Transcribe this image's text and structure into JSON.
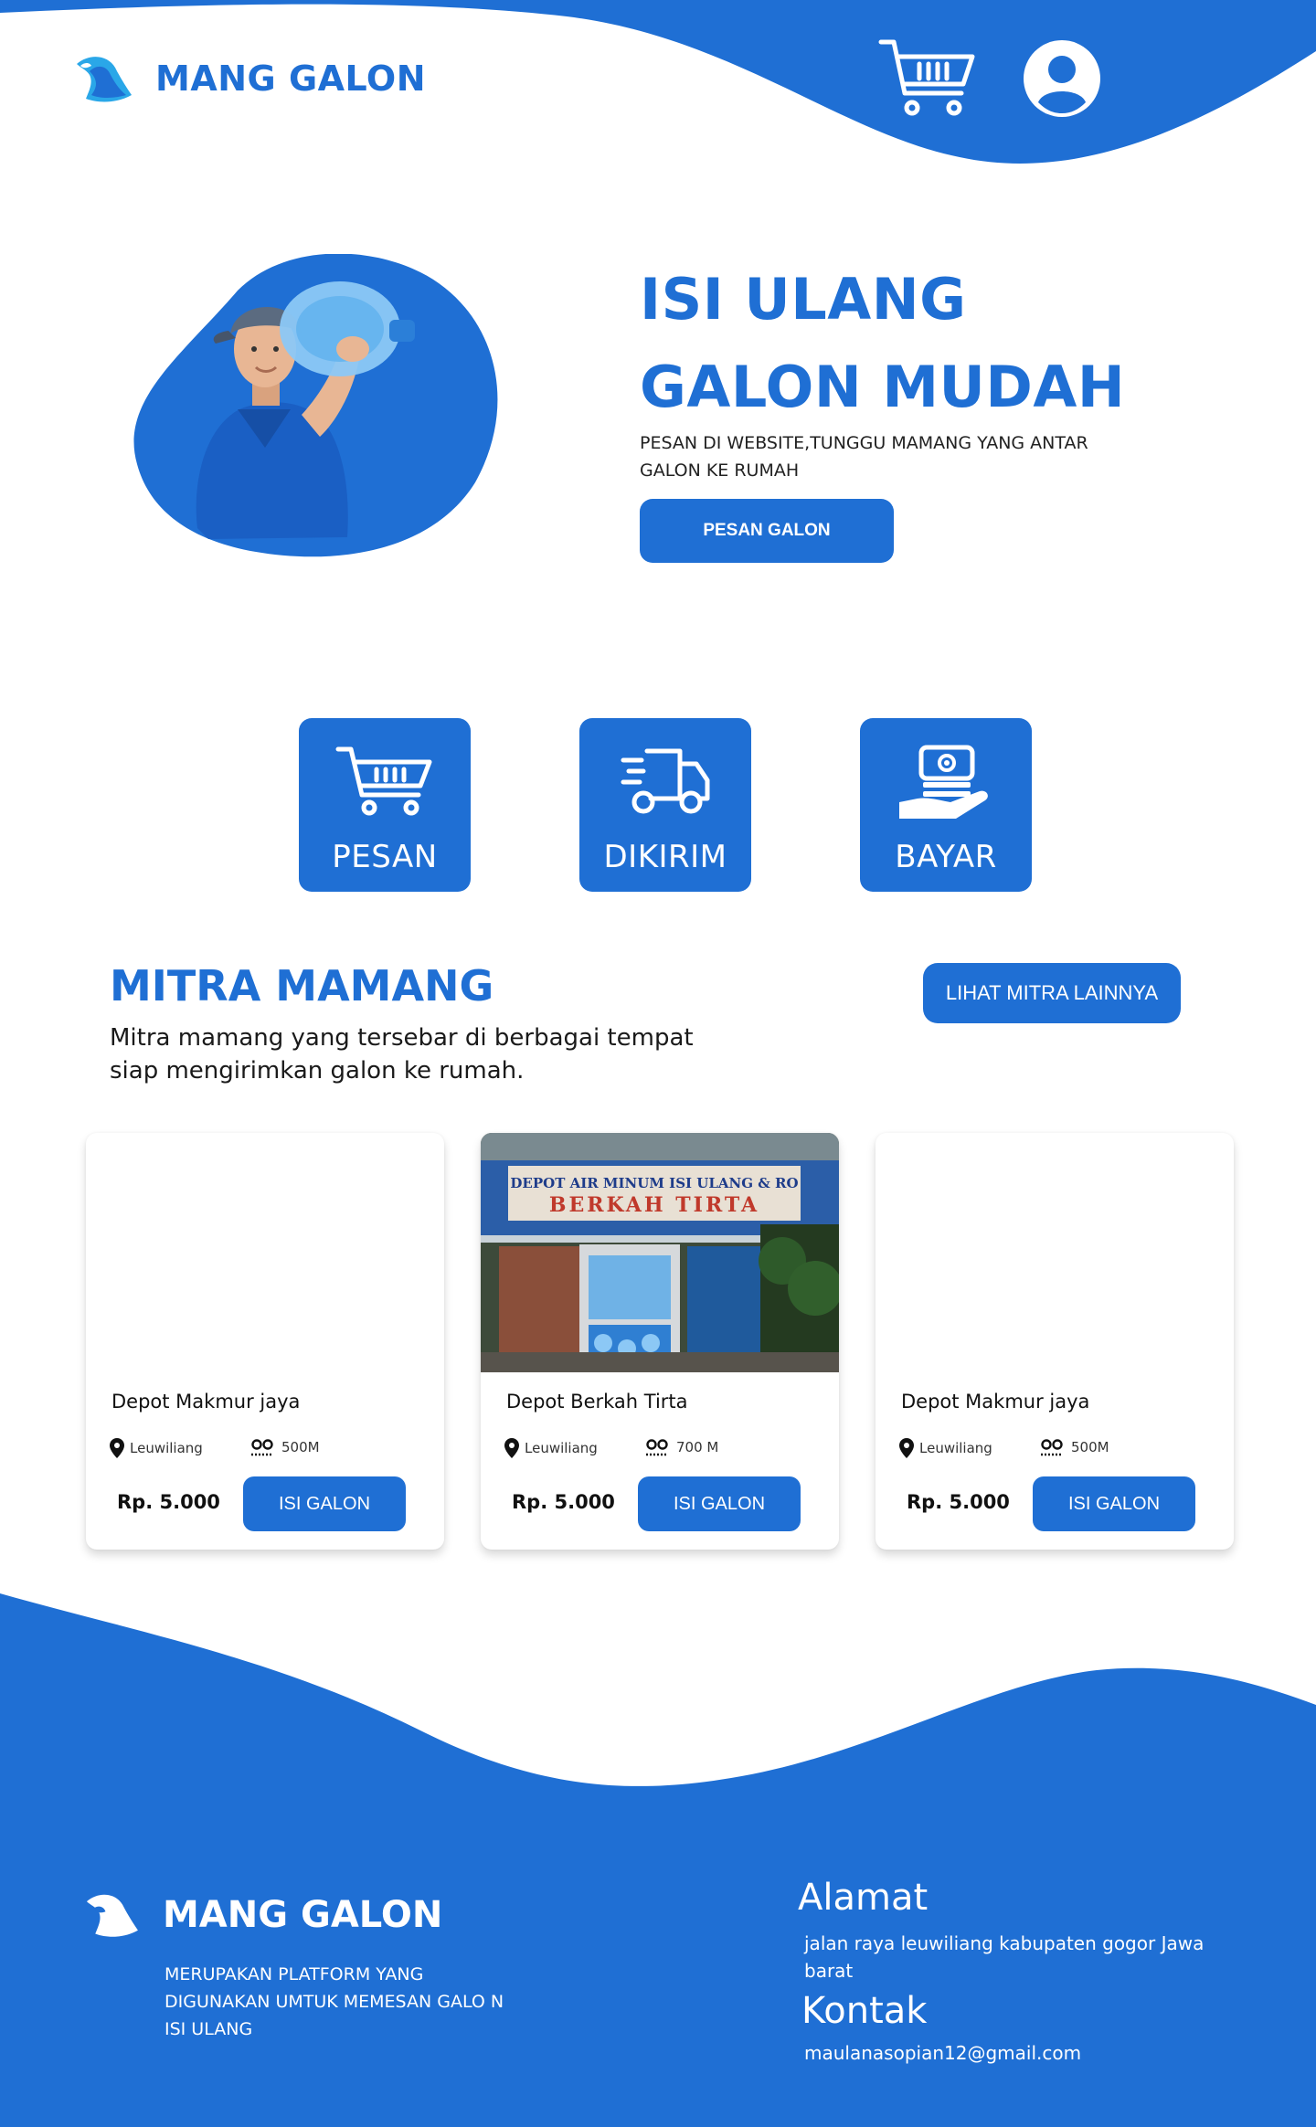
{
  "brand": {
    "name": "MANG GALON",
    "color": "#1f6fd4"
  },
  "header": {
    "cart_icon": "cart-icon",
    "profile_icon": "user-avatar-icon"
  },
  "hero": {
    "title_line1": "ISI ULANG",
    "title_line2": "GALON MUDAH",
    "description": "PESAN DI WEBSITE,TUNGGU MAMANG YANG ANTAR GALON KE RUMAH",
    "button_label": "PESAN GALON"
  },
  "steps": [
    {
      "label": "PESAN",
      "icon": "cart-icon"
    },
    {
      "label": "DIKIRIM",
      "icon": "delivery-truck-icon"
    },
    {
      "label": "BAYAR",
      "icon": "cash-hand-icon"
    }
  ],
  "mitra": {
    "title": "MITRA MAMANG",
    "description": "Mitra mamang yang tersebar di berbagai tempat siap mengirimkan galon ke rumah.",
    "more_button": "LIHAT MITRA LAINNYA",
    "cards": [
      {
        "name": "Depot Makmur jaya",
        "location": "Leuwiliang",
        "distance": "500M",
        "price": "Rp. 5.000",
        "button": "ISI GALON",
        "has_image": false
      },
      {
        "name": "Depot Berkah Tirta",
        "location": "Leuwiliang",
        "distance": "700 M",
        "price": "Rp. 5.000",
        "button": "ISI GALON",
        "has_image": true,
        "sign_line1": "DEPOT AIR MINUM ISI ULANG & RO",
        "sign_line2": "BERKAH TIRTA"
      },
      {
        "name": "Depot Makmur jaya",
        "location": "Leuwiliang",
        "distance": "500M",
        "price": "Rp. 5.000",
        "button": "ISI GALON",
        "has_image": false
      }
    ]
  },
  "footer": {
    "brand": "MANG GALON",
    "description": "MERUPAKAN PLATFORM YANG DIGUNAKAN UMTUK MEMESAN GALO N ISI ULANG",
    "address_heading": "Alamat",
    "address": "jalan raya leuwiliang kabupaten gogor  Jawa barat",
    "contact_heading": "Kontak",
    "email": "maulanasopian12@gmail.com"
  }
}
